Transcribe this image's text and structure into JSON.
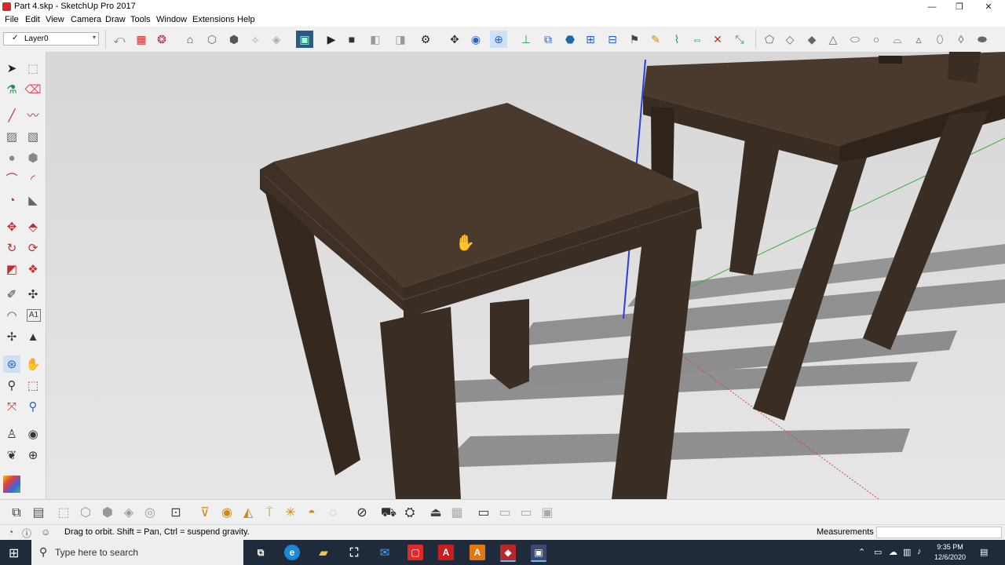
{
  "window": {
    "title": "Part 4.skp - SketchUp Pro 2017",
    "controls": [
      "—",
      "❐",
      "✕"
    ]
  },
  "menu": [
    "File",
    "Edit",
    "View",
    "Camera",
    "Draw",
    "Tools",
    "Window",
    "Extensions",
    "Help"
  ],
  "layer": {
    "check": "✓",
    "name": "Layer0",
    "arrow": "▾"
  },
  "status": {
    "hint": "Drag to orbit. Shift = Pan, Ctrl = suspend gravity.",
    "measurements_label": "Measurements",
    "measurements_value": ""
  },
  "taskbar": {
    "search_placeholder": "Type here to search",
    "time": "9:35 PM",
    "date": "12/6/2020",
    "apps": [
      "e",
      "A",
      "A"
    ]
  },
  "colors": {
    "wood_top": "#4a3a2e",
    "wood_side": "#3a2d24",
    "wood_dark": "#2b211a",
    "ground": "#e3e3e3",
    "sky": "#dcdcdc",
    "shadow": "#8d8d8d",
    "taskbar": "#1f2b3a",
    "axis_red": "#d84444",
    "axis_green": "#3fae3f",
    "axis_blue": "#2a3fd8"
  },
  "icons": {
    "toolbar": [
      "arrow-curve-icon",
      "building-icon",
      "components-icon",
      "3d-warehouse-icon",
      "box-iso-icon",
      "box-front-icon",
      "box-top-icon",
      "sandbox-icon",
      "extension-icon",
      "play-icon",
      "stop-icon",
      "record-icon",
      "gear-icon",
      "axes-icon",
      "section-icon",
      "orbit-icon",
      "views-icon",
      "flag-icon",
      "pencil-icon",
      "shapes-icon"
    ],
    "left": [
      "select-icon",
      "component-icon",
      "paint-bucket-icon",
      "eraser-icon",
      "line-icon",
      "freehand-icon",
      "rectangle-icon",
      "rotated-rect-icon",
      "circle-icon",
      "polygon-icon",
      "arc-icon",
      "2pt-arc-icon",
      "pie-icon",
      "3pt-arc-icon",
      "move-icon",
      "push-pull-icon",
      "rotate-icon",
      "follow-me-icon",
      "scale-icon",
      "offset-icon",
      "tape-measure-icon",
      "dimension-icon",
      "protractor-icon",
      "text-icon",
      "axes-tool-icon",
      "3d-text-icon",
      "orbit-tool-icon",
      "pan-icon",
      "zoom-icon",
      "zoom-window-icon",
      "zoom-extents-icon",
      "zoom-previous-icon",
      "position-camera-icon",
      "look-around-icon",
      "walk-icon",
      "section-plane-icon",
      "style-icon"
    ],
    "bottom": [
      "layers-icon",
      "styles-icon",
      "xray-icon",
      "wireframe-icon",
      "hidden-line-icon",
      "shaded-icon",
      "monochrome-icon",
      "sandbox-tool-icon",
      "solid-tools-icon",
      "shadow-icon",
      "fog-icon",
      "scenes-icon"
    ]
  }
}
